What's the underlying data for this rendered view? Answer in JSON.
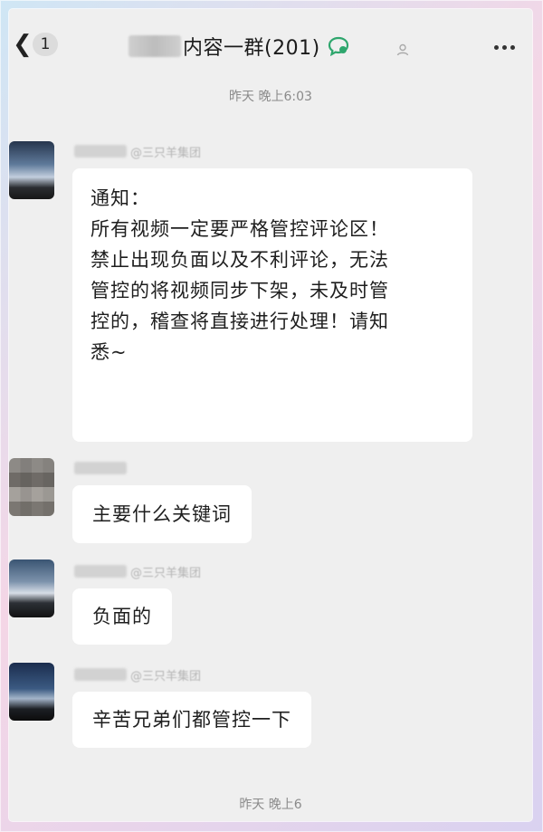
{
  "header": {
    "back_chevron": "❮",
    "unread_count": "1",
    "group_title": "内容一群(201)",
    "icons": [
      "chevron-left-icon",
      "chat-bubble-icon",
      "person-icon",
      "more-icon"
    ]
  },
  "messages": [
    {
      "timestamp": "昨天 晚上6:03",
      "company": "@三只羊集团",
      "text": "通知：\n所有视频一定要严格管控评论区！\n禁止出现负面以及不利评论，无法\n管控的将视频同步下架，未及时管\n控的，稽查将直接进行处理！请知\n悉~"
    },
    {
      "company": "",
      "text": "主要什么关键词"
    },
    {
      "company": "@三只羊集团",
      "text": "负面的"
    },
    {
      "company": "@三只羊集团",
      "text": "辛苦兄弟们都管控一下"
    }
  ],
  "footer_timestamp": "昨天 晚上6",
  "colors": {
    "screen_bg": "#efefef",
    "bubble": "#ffffff",
    "accent": "#2ea66d"
  }
}
